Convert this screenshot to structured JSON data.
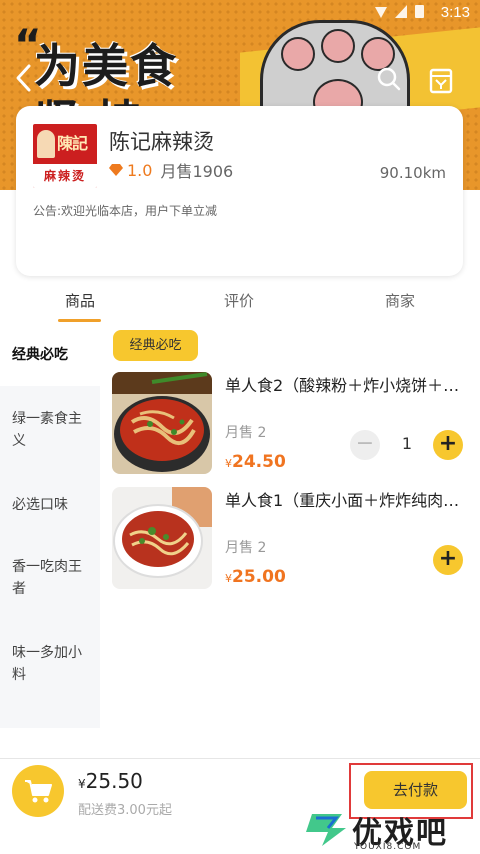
{
  "status_bar": {
    "time": "3:13"
  },
  "banner": {
    "slogan_line1": "为美食",
    "slogan_line2": "坚 持",
    "quote_mark": "“"
  },
  "shop": {
    "logo_text_top": "陳記",
    "logo_text_bottom": "麻辣烫",
    "name": "陈记麻辣烫",
    "rating": "1.0",
    "monthly_sales": "月售1906",
    "distance": "90.10km",
    "notice": "公告:欢迎光临本店，用户下单立减"
  },
  "tabs": [
    {
      "label": "商品"
    },
    {
      "label": "评价"
    },
    {
      "label": "商家"
    }
  ],
  "sidebar": {
    "items": [
      {
        "label": "经典必吃"
      },
      {
        "label": "绿一素食主义"
      },
      {
        "label": "必选口味"
      },
      {
        "label": "香一吃肉王者"
      },
      {
        "label": "味一多加小料"
      }
    ]
  },
  "category_badge": "经典必吃",
  "dishes": [
    {
      "name": "单人食2（酸辣粉＋炸小烧饼＋…",
      "sales": "月售 2",
      "currency": "¥",
      "price": "24.50",
      "quantity": "1"
    },
    {
      "name": "单人食1（重庆小面＋炸炸纯肉…",
      "sales": "月售 2",
      "currency": "¥",
      "price": "25.00"
    }
  ],
  "cart": {
    "currency": "¥",
    "total": "25.50",
    "delivery": "配送费3.00元起",
    "pay_label": "去付款"
  },
  "watermark": {
    "text": "优戏吧",
    "url": "YOUXI8.COM"
  },
  "colors": {
    "accent": "#f7c72e",
    "price": "#f07420",
    "banner": "#e8962a"
  }
}
